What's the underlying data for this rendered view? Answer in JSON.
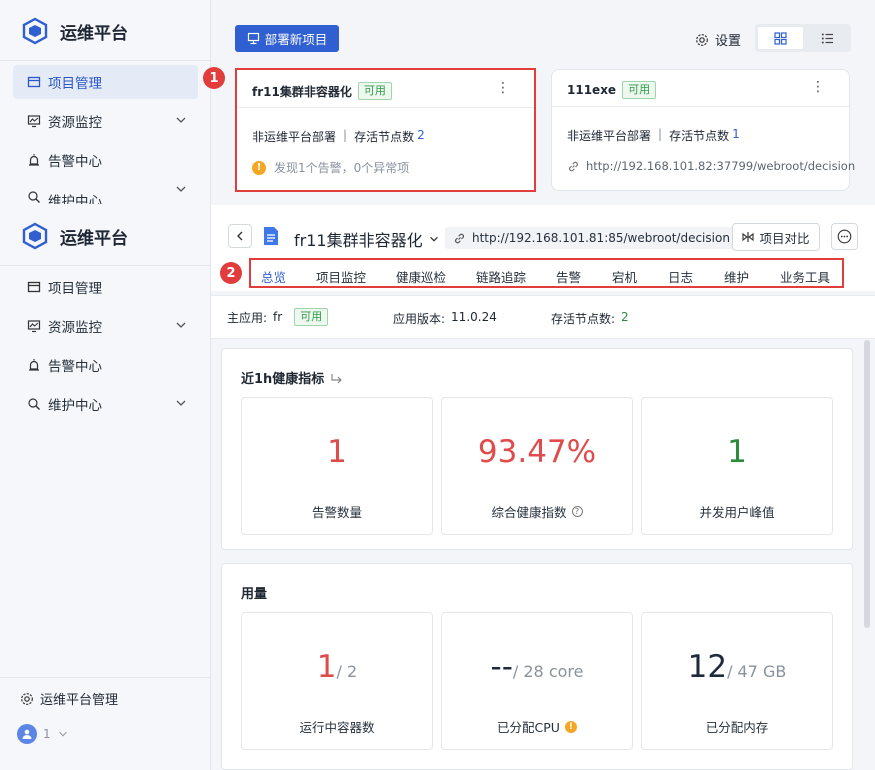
{
  "app": {
    "title": "运维平台"
  },
  "sidebar": {
    "items": [
      {
        "label": "项目管理",
        "icon": "project-icon",
        "active": true
      },
      {
        "label": "资源监控",
        "icon": "monitor-icon",
        "expandable": true
      },
      {
        "label": "告警中心",
        "icon": "alarm-icon"
      },
      {
        "label": "维护中心",
        "icon": "maintenance-icon",
        "expandable": true
      }
    ],
    "footer": {
      "settings_label": "运维平台管理",
      "user_name": "1"
    }
  },
  "header": {
    "deploy_button": "部署新项目",
    "settings_label": "设置"
  },
  "project_cards": [
    {
      "name": "fr11集群非容器化",
      "status": "可用",
      "type": "非运维平台部署",
      "nodes_label": "存活节点数",
      "nodes": "2",
      "alert": "发现1个告警，0个异常项"
    },
    {
      "name": "111exe",
      "status": "可用",
      "type": "非运维平台部署",
      "nodes_label": "存活节点数",
      "nodes": "1",
      "url": "http://192.168.101.82:37799/webroot/decision"
    }
  ],
  "annotations": {
    "badge1": "1",
    "badge2": "2"
  },
  "detail": {
    "project_name": "fr11集群非容器化",
    "url": "http://192.168.101.81:85/webroot/decision",
    "compare_button": "项目对比",
    "tabs": [
      "总览",
      "项目监控",
      "健康巡检",
      "链路追踪",
      "告警",
      "宕机",
      "日志",
      "维护",
      "业务工具"
    ],
    "info": {
      "main_app_label": "主应用:",
      "main_app": "fr",
      "main_app_status": "可用",
      "version_label": "应用版本:",
      "version": "11.0.24",
      "nodes_label": "存活节点数:",
      "nodes": "2"
    },
    "health": {
      "title": "近1h健康指标",
      "metrics": [
        {
          "value": "1",
          "label": "告警数量",
          "color": "#e04b4b"
        },
        {
          "value": "93.47%",
          "label": "综合健康指数",
          "color": "#e04b4b"
        },
        {
          "value": "1",
          "label": "并发用户峰值",
          "color": "#2e8b3e"
        }
      ]
    },
    "usage": {
      "title": "用量",
      "metrics": [
        {
          "value": "1",
          "total": "/ 2",
          "label": "运行中容器数",
          "color": "#e04b4b"
        },
        {
          "value": "--",
          "total": "/ 28 core",
          "label": "已分配CPU",
          "color": "#1f2b3d"
        },
        {
          "value": "12",
          "total": "/ 47 GB",
          "label": "已分配内存",
          "color": "#1f2b3d"
        }
      ]
    }
  },
  "colors": {
    "primary": "#2f5fd0",
    "annotation_red": "#e23d3d",
    "ok_green": "#2e9c45",
    "warn_orange": "#f5a623"
  }
}
